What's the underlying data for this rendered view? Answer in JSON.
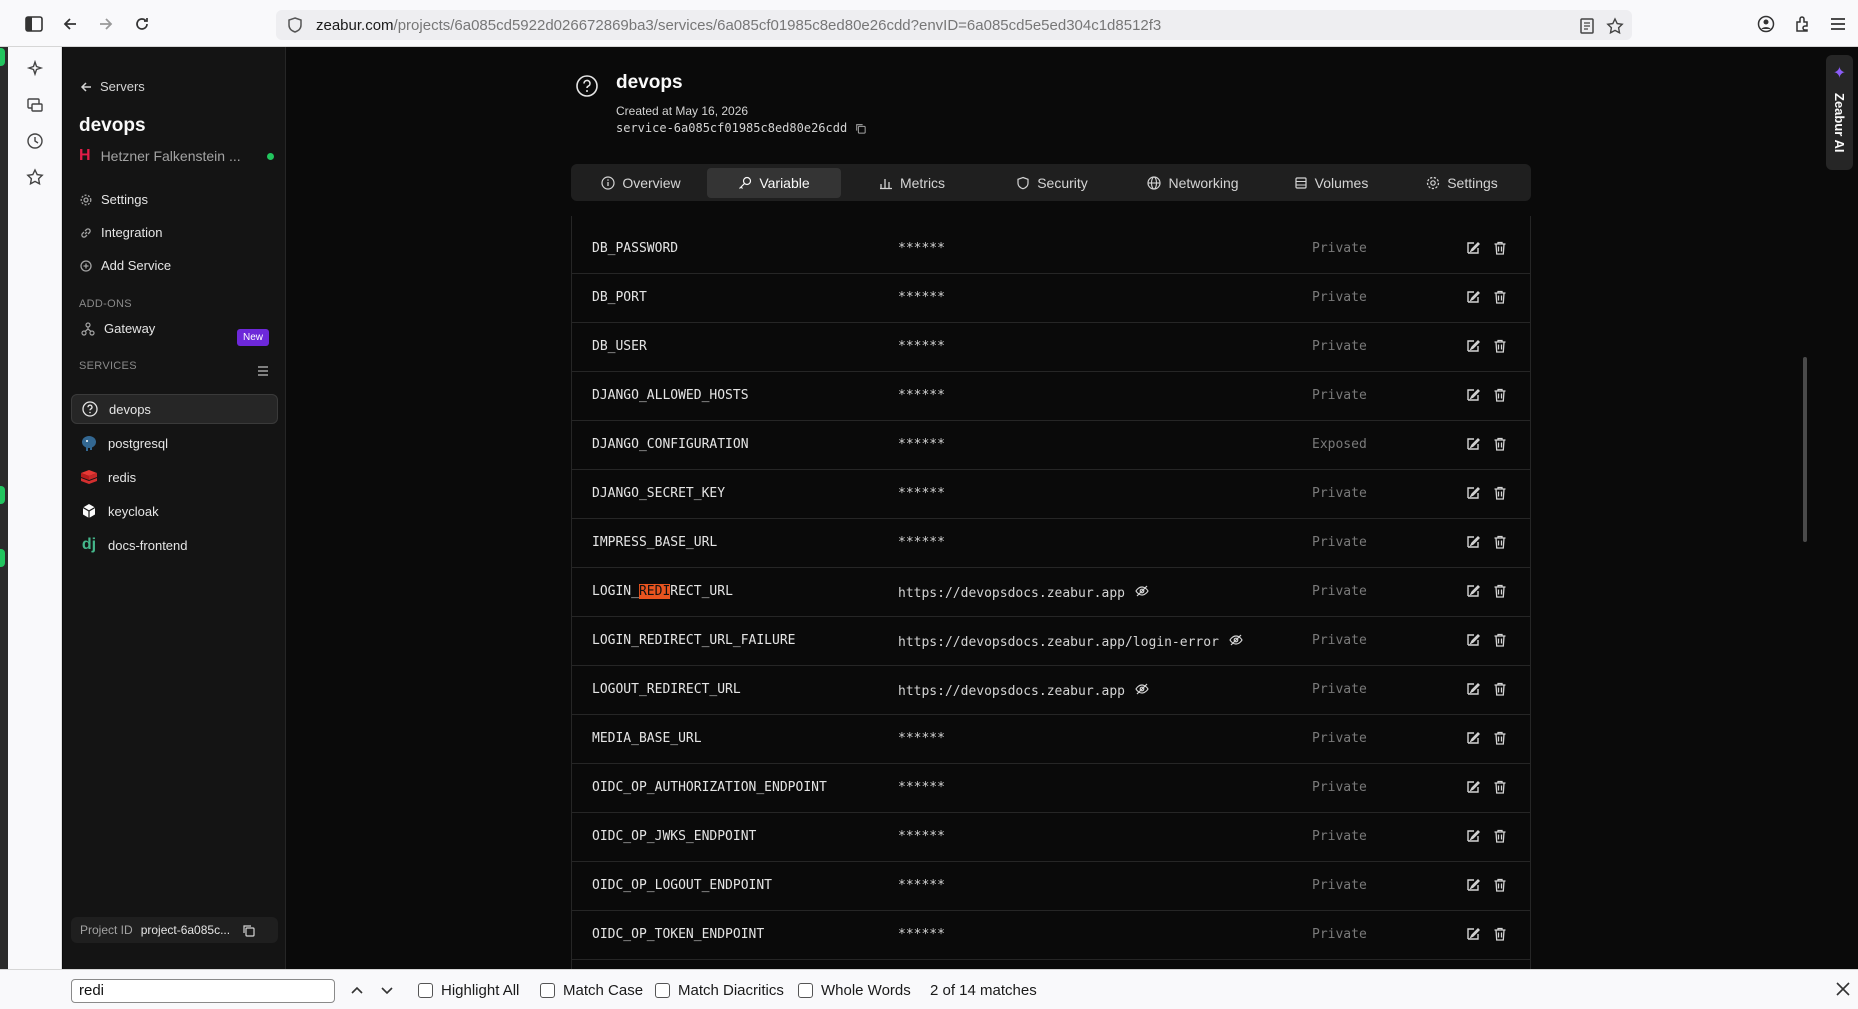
{
  "browser": {
    "url_host": "zeabur.com",
    "url_path": "/projects/6a085cd5922d026672869ba3/services/6a085cf01985c8ed80e26cdd?envID=6a085cd5e5ed304c1d8512f3"
  },
  "sidebar": {
    "back_label": "Servers",
    "project_name": "devops",
    "server_name": "Hetzner Falkenstein ...",
    "links": [
      "Settings",
      "Integration",
      "Add Service"
    ],
    "addons_label": "ADD-ONS",
    "gateway_label": "Gateway",
    "gateway_badge": "New",
    "services_label": "SERVICES",
    "services": [
      "devops",
      "postgresql",
      "redis",
      "keycloak",
      "docs-frontend"
    ],
    "project_id_label": "Project ID",
    "project_id_value": "project-6a085c..."
  },
  "service": {
    "name": "devops",
    "created": "Created at May 16, 2026",
    "id": "service-6a085cf01985c8ed80e26cdd"
  },
  "tabs": [
    "Overview",
    "Variable",
    "Metrics",
    "Security",
    "Networking",
    "Volumes",
    "Settings"
  ],
  "active_tab": "Variable",
  "variables": [
    {
      "key": "DB_PASSWORD",
      "value": "******",
      "visibility": "Private"
    },
    {
      "key": "DB_PORT",
      "value": "******",
      "visibility": "Private"
    },
    {
      "key": "DB_USER",
      "value": "******",
      "visibility": "Private"
    },
    {
      "key": "DJANGO_ALLOWED_HOSTS",
      "value": "******",
      "visibility": "Private"
    },
    {
      "key": "DJANGO_CONFIGURATION",
      "value": "******",
      "visibility": "Exposed"
    },
    {
      "key": "DJANGO_SECRET_KEY",
      "value": "******",
      "visibility": "Private"
    },
    {
      "key": "IMPRESS_BASE_URL",
      "value": "******",
      "visibility": "Private"
    },
    {
      "key_pre": "LOGIN_",
      "key_hl": "REDI",
      "key_post": "RECT_URL",
      "value": "https://devopsdocs.zeabur.app",
      "visibility": "Private",
      "revealed": true
    },
    {
      "key": "LOGIN_REDIRECT_URL_FAILURE",
      "value": "https://devopsdocs.zeabur.app/login-error",
      "visibility": "Private",
      "revealed": true
    },
    {
      "key": "LOGOUT_REDIRECT_URL",
      "value": "https://devopsdocs.zeabur.app",
      "visibility": "Private",
      "revealed": true
    },
    {
      "key": "MEDIA_BASE_URL",
      "value": "******",
      "visibility": "Private"
    },
    {
      "key": "OIDC_OP_AUTHORIZATION_ENDPOINT",
      "value": "******",
      "visibility": "Private"
    },
    {
      "key": "OIDC_OP_JWKS_ENDPOINT",
      "value": "******",
      "visibility": "Private"
    },
    {
      "key": "OIDC_OP_LOGOUT_ENDPOINT",
      "value": "******",
      "visibility": "Private"
    },
    {
      "key": "OIDC_OP_TOKEN_ENDPOINT",
      "value": "******",
      "visibility": "Private"
    }
  ],
  "zeabur_ai": "Zeabur AI",
  "findbar": {
    "query": "redi",
    "options": [
      "Highlight All",
      "Match Case",
      "Match Diacritics",
      "Whole Words"
    ],
    "count": "2 of 14 matches"
  },
  "colors": {
    "accent_new": "#6d28d9",
    "highlight": "#e8541f",
    "status_ok": "#22c55e"
  }
}
